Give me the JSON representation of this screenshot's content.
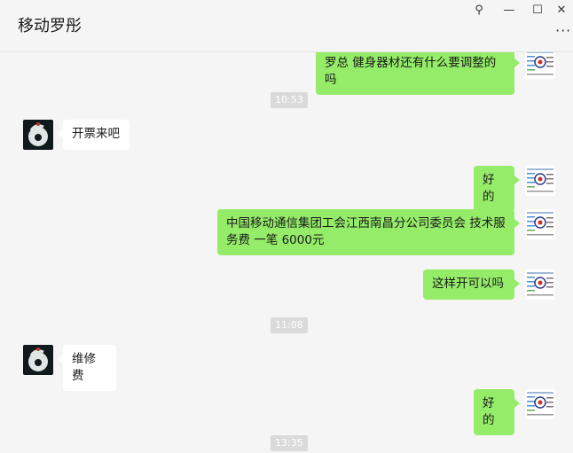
{
  "window": {
    "title": "移动罗彤",
    "pin_glyph": "⚲",
    "minimize_glyph": "—",
    "maximize_glyph": "☐",
    "close_glyph": "✕",
    "more_glyph": "···"
  },
  "messages": [
    {
      "type": "text",
      "side": "out",
      "text": "罗总 健身器材还有什么要调整的吗"
    },
    {
      "type": "time",
      "text": "10:53"
    },
    {
      "type": "text",
      "side": "in",
      "text": "开票来吧"
    },
    {
      "type": "text",
      "side": "out",
      "text": "好的"
    },
    {
      "type": "text",
      "side": "out",
      "text": "中国移动通信集团工会江西南昌分公司委员会  技术服务费 一笔 6000元"
    },
    {
      "type": "text",
      "side": "out",
      "text": "这样开可以吗"
    },
    {
      "type": "time",
      "text": "11:08"
    },
    {
      "type": "text",
      "side": "in",
      "text": "维修费"
    },
    {
      "type": "text",
      "side": "out",
      "text": "好的"
    },
    {
      "type": "time",
      "text": "13:35"
    }
  ],
  "colors": {
    "outgoing_bubble": "#95ec69",
    "incoming_bubble": "#ffffff",
    "background": "#f5f5f5",
    "timestamp_bg": "#dadada"
  },
  "icons": {
    "contact_avatar": "dark-circle-avatar",
    "self_avatar": "document-thumbnail-avatar"
  }
}
